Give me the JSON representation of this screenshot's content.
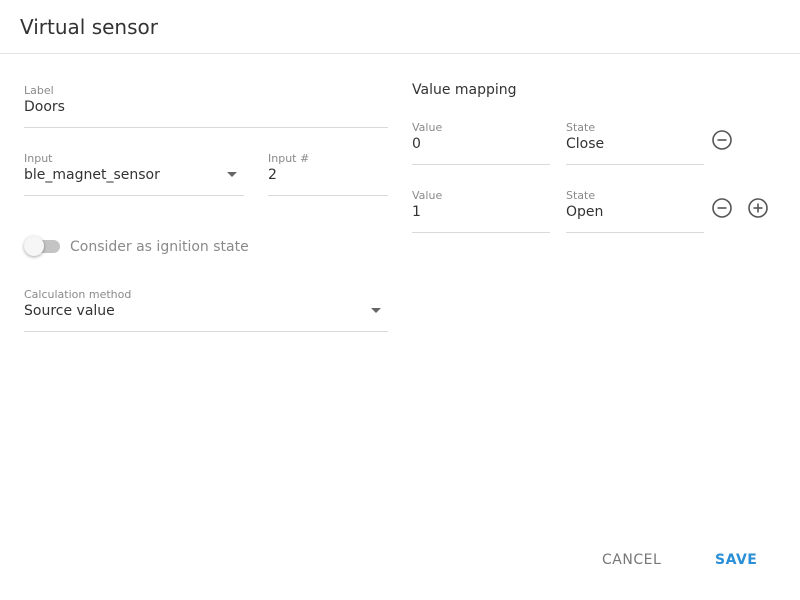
{
  "dialog": {
    "title": "Virtual sensor"
  },
  "form": {
    "label_field": {
      "label": "Label",
      "value": "Doors"
    },
    "input_field": {
      "label": "Input",
      "value": "ble_magnet_sensor"
    },
    "input_number_field": {
      "label": "Input #",
      "value": "2"
    },
    "ignition_toggle": {
      "label": "Consider as ignition state",
      "checked": false
    },
    "calculation_method": {
      "label": "Calculation method",
      "value": "Source value"
    }
  },
  "value_mapping": {
    "title": "Value mapping",
    "rows": [
      {
        "value_label": "Value",
        "value": "0",
        "state_label": "State",
        "state": "Close"
      },
      {
        "value_label": "Value",
        "value": "1",
        "state_label": "State",
        "state": "Open"
      }
    ]
  },
  "footer": {
    "cancel_label": "CANCEL",
    "save_label": "SAVE"
  },
  "colors": {
    "accent": "#2a8fd6",
    "muted_text": "#8a8a8a",
    "divider": "#d9d9d9"
  },
  "icons": {
    "remove": "minus-circle-icon",
    "add": "plus-circle-icon",
    "dropdown": "chevron-down-icon"
  }
}
